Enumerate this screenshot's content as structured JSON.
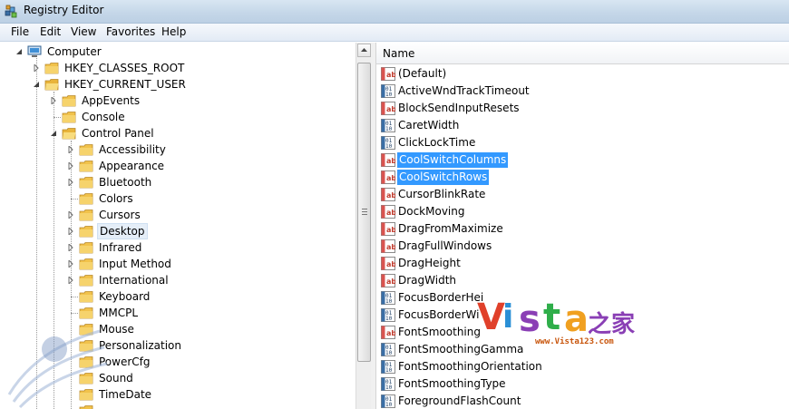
{
  "window": {
    "title": "Registry Editor"
  },
  "menu": [
    "File",
    "Edit",
    "View",
    "Favorites",
    "Help"
  ],
  "tree": {
    "root": "Computer",
    "hkcr": "HKEY_CLASSES_ROOT",
    "hkcu": "HKEY_CURRENT_USER",
    "hkcu_children": [
      "AppEvents",
      "Console",
      "Control Panel"
    ],
    "control_panel_children": [
      "Accessibility",
      "Appearance",
      "Bluetooth",
      "Colors",
      "Cursors",
      "Desktop",
      "Infrared",
      "Input Method",
      "International",
      "Keyboard",
      "MMCPL",
      "Mouse",
      "Personalization",
      "PowerCfg",
      "Sound",
      "TimeDate"
    ],
    "selected": "Desktop"
  },
  "list": {
    "column_name": "Name",
    "values": [
      {
        "name": "(Default)",
        "type": "string"
      },
      {
        "name": "ActiveWndTrackTimeout",
        "type": "binary"
      },
      {
        "name": "BlockSendInputResets",
        "type": "string"
      },
      {
        "name": "CaretWidth",
        "type": "binary"
      },
      {
        "name": "ClickLockTime",
        "type": "binary"
      },
      {
        "name": "CoolSwitchColumns",
        "type": "string",
        "selected": true
      },
      {
        "name": "CoolSwitchRows",
        "type": "string",
        "selected": true
      },
      {
        "name": "CursorBlinkRate",
        "type": "string"
      },
      {
        "name": "DockMoving",
        "type": "string"
      },
      {
        "name": "DragFromMaximize",
        "type": "string"
      },
      {
        "name": "DragFullWindows",
        "type": "string"
      },
      {
        "name": "DragHeight",
        "type": "string"
      },
      {
        "name": "DragWidth",
        "type": "string"
      },
      {
        "name": "FocusBorderHei",
        "type": "binary"
      },
      {
        "name": "FocusBorderWi",
        "type": "binary"
      },
      {
        "name": "FontSmoothing",
        "type": "string"
      },
      {
        "name": "FontSmoothingGamma",
        "type": "binary"
      },
      {
        "name": "FontSmoothingOrientation",
        "type": "binary"
      },
      {
        "name": "FontSmoothingType",
        "type": "binary"
      },
      {
        "name": "ForegroundFlashCount",
        "type": "binary"
      }
    ]
  },
  "watermark": {
    "letters": [
      "V",
      "i",
      "s",
      "t",
      "a"
    ],
    "suffix": "之家",
    "url": "www.Vista123.com"
  },
  "colors": {
    "selection": "#3399ff",
    "folder": "#f1c24b"
  }
}
